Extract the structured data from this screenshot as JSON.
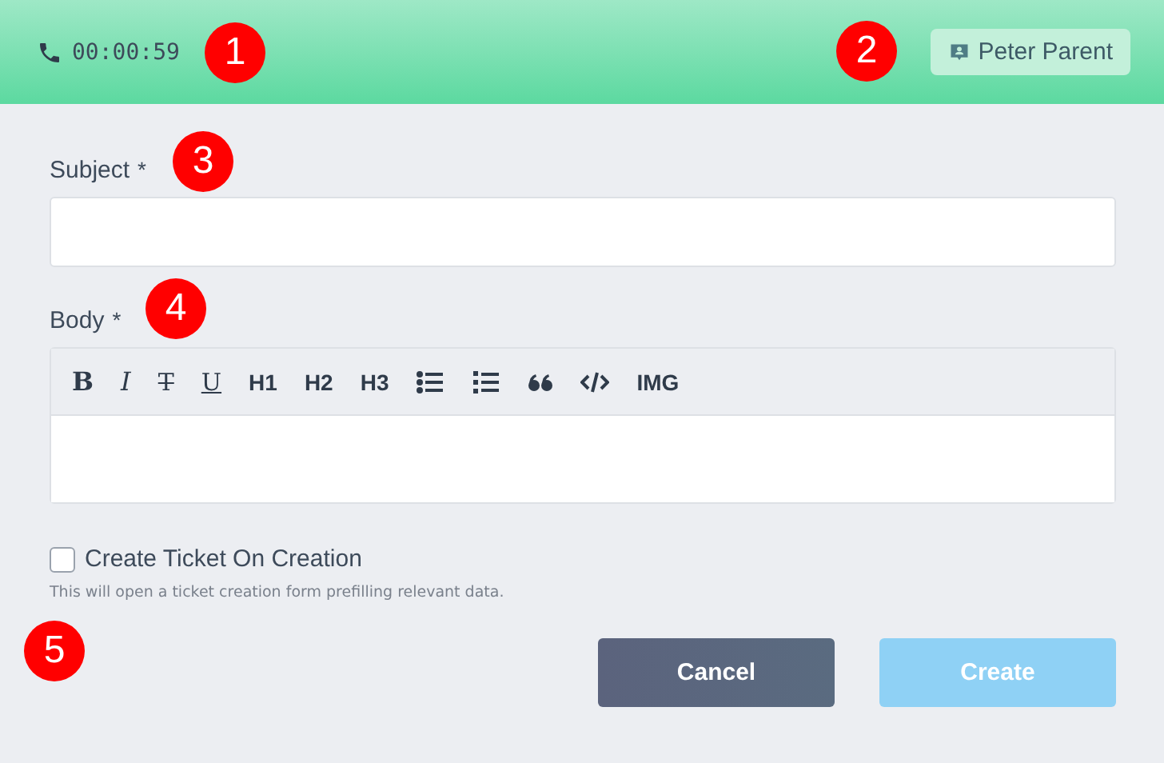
{
  "call_bar": {
    "timer": "00:00:59",
    "contact": "Peter Parent"
  },
  "form": {
    "subject": {
      "label": "Subject",
      "required_mark": "*"
    },
    "body": {
      "label": "Body",
      "required_mark": "*",
      "toolbar": [
        {
          "kind": "bold",
          "label": "B"
        },
        {
          "kind": "italic",
          "label": "I"
        },
        {
          "kind": "strike",
          "label": "T"
        },
        {
          "kind": "underline",
          "label": "U"
        },
        {
          "kind": "text",
          "label": "H1"
        },
        {
          "kind": "text",
          "label": "H2"
        },
        {
          "kind": "text",
          "label": "H3"
        },
        {
          "kind": "bullet-list"
        },
        {
          "kind": "numbered-list"
        },
        {
          "kind": "quote"
        },
        {
          "kind": "code"
        },
        {
          "kind": "text",
          "label": "IMG"
        }
      ]
    },
    "create_ticket": {
      "label": "Create Ticket On Creation",
      "checked": false,
      "hint": "This will open a ticket creation form prefilling relevant data."
    },
    "buttons": [
      {
        "label": "Cancel",
        "kind": "secondary",
        "disabled": false
      },
      {
        "label": "Create",
        "kind": "primary",
        "disabled": true
      }
    ]
  },
  "callouts": [
    "1",
    "2",
    "3",
    "4",
    "5"
  ]
}
